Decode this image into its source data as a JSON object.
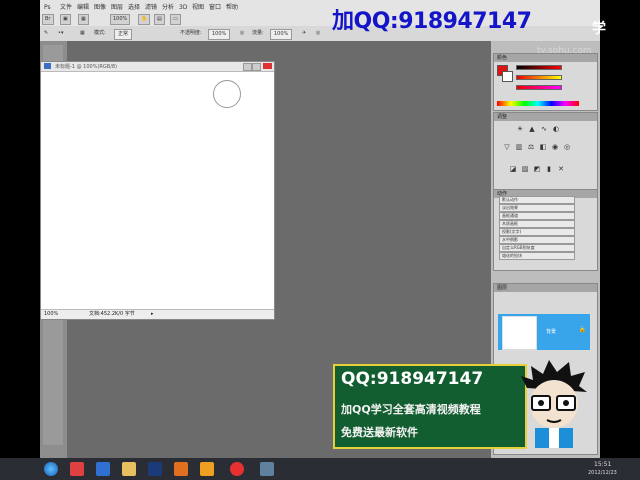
{
  "menubar": {
    "items": [
      "文件",
      "编辑",
      "图像",
      "图层",
      "选择",
      "滤镜",
      "分析",
      "3D",
      "视图",
      "窗口",
      "帮助"
    ],
    "zoom": "100%"
  },
  "options": {
    "mode_label": "模式:",
    "mode_value": "正常",
    "opacity_label": "不透明度:",
    "opacity_value": "100%",
    "flow_label": "流量:",
    "flow_value": "100%"
  },
  "document": {
    "title": "未标题-1 @ 100%(RGB/8)",
    "status": "文档:452.2K/0 字节"
  },
  "panels": {
    "color_header": "颜色",
    "adjust_header": "调整",
    "actions_header": "动作",
    "actions": [
      "默认动作",
      "淡出效果",
      "画框通道",
      "木质画框",
      "投影(文字)",
      "水中倒影",
      "自定义RGB到灰度",
      "熔化的铅块"
    ],
    "layers_header": "图层",
    "layer_name": "背景"
  },
  "watermark": {
    "qq": "加QQ:918947147",
    "suffix": "学",
    "site": "tv.sohu.com"
  },
  "promo": {
    "qq": "QQ:918947147",
    "line1": "加QQ学习全套高清视频教程",
    "line2": "免费送最新软件"
  },
  "taskbar": {
    "clock_time": "15:51",
    "clock_date": "2012/12/23"
  },
  "colors": {
    "canvas_bg": "#6b6b6b",
    "foreground": "#e01212",
    "layer_highlight": "#38a4ea",
    "promo_bg": "#135e30"
  }
}
